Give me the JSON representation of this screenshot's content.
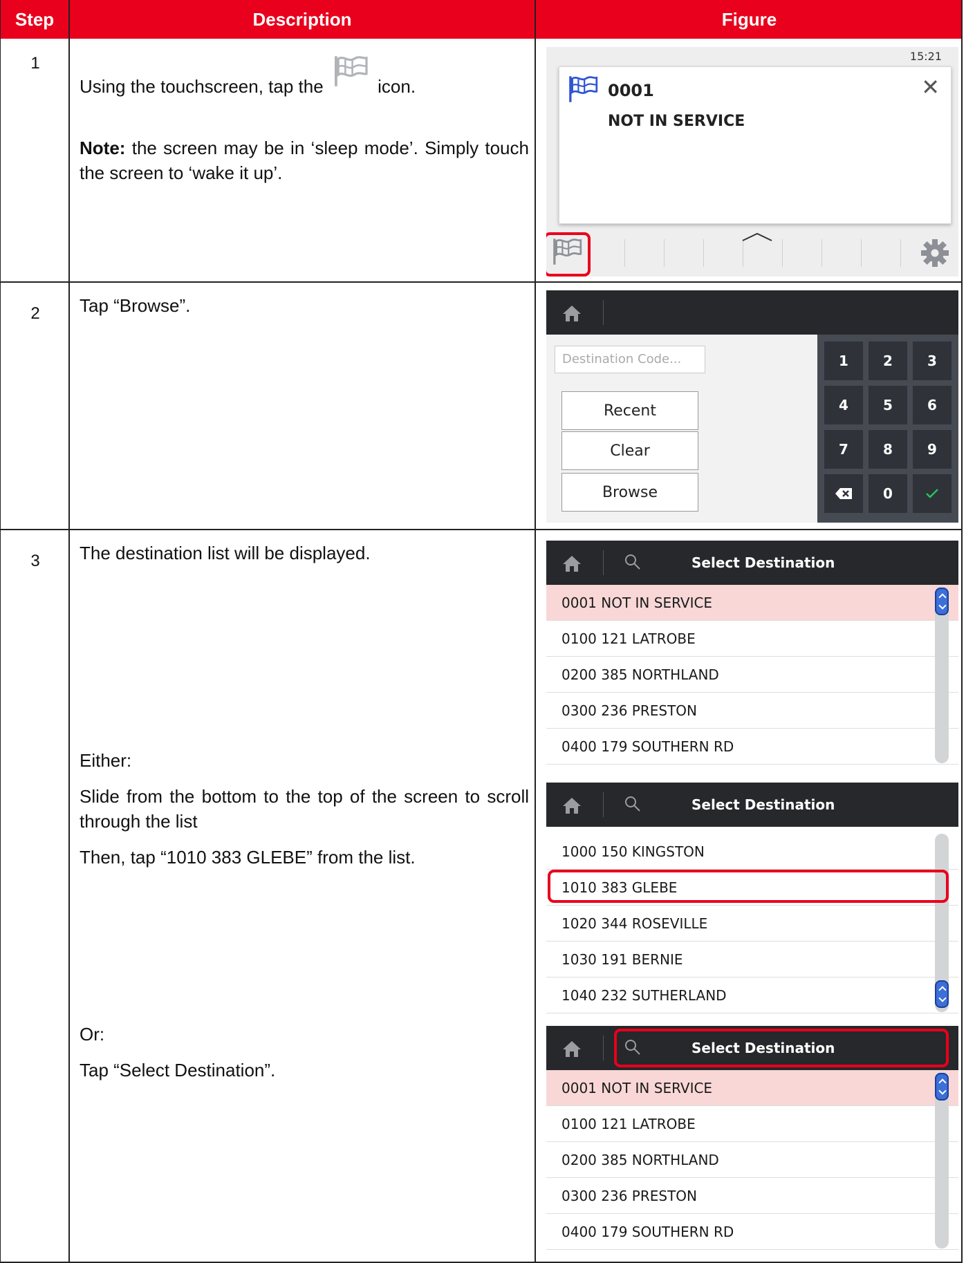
{
  "table": {
    "headers": {
      "step": "Step",
      "description": "Description",
      "figure": "Figure"
    }
  },
  "steps": [
    {
      "number": "1",
      "text_before_icon": "Using the touchscreen, tap the",
      "text_after_icon": "icon.",
      "note_label": "Note:",
      "note_text": "the screen may be in ‘sleep mode’. Simply touch the screen to ‘wake it up’."
    },
    {
      "number": "2",
      "text": "Tap “Browse”."
    },
    {
      "number": "3",
      "text": "The destination list will be displayed.",
      "either": "Either:",
      "slide": "Slide from the bottom to the top of the screen to scroll through the list",
      "then": "Then, tap “1010 383 GLEBE” from the list.",
      "or": "Or:",
      "tap_select": "Tap “Select Destination”."
    }
  ],
  "fig1": {
    "time": "15:21",
    "code": "0001",
    "status": "NOT IN SERVICE",
    "icons": [
      "flag-icon",
      "close-icon",
      "chevron-up-icon",
      "gear-icon"
    ]
  },
  "fig2": {
    "input_placeholder": "Destination Code...",
    "buttons": {
      "recent": "Recent",
      "clear": "Clear",
      "browse": "Browse"
    },
    "keys": [
      "1",
      "2",
      "3",
      "4",
      "5",
      "6",
      "7",
      "8",
      "9",
      "",
      "0",
      ""
    ],
    "key_icons": {
      "backspace": "backspace-icon",
      "confirm": "check-icon"
    },
    "accent": "#27c25b"
  },
  "lists": {
    "title": "Select Destination",
    "list_a": [
      "0001 NOT IN SERVICE",
      "0100 121 LATROBE",
      "0200 385 NORTHLAND",
      "0300 236 PRESTON",
      "0400 179 SOUTHERN RD"
    ],
    "list_b": [
      "1000 150 KINGSTON",
      "1010 383 GLEBE",
      "1020 344 ROSEVILLE",
      "1030 191 BERNIE",
      "1040 232 SUTHERLAND"
    ],
    "list_c": [
      "0001 NOT IN SERVICE",
      "0100 121 LATROBE",
      "0200 385 NORTHLAND",
      "0300 236 PRESTON",
      "0400 179 SOUTHERN RD"
    ]
  },
  "colors": {
    "header_red": "#e8001c",
    "highlight_red": "#e8001c",
    "selected_row": "#f9d7d7",
    "topbar": "#26282b"
  }
}
